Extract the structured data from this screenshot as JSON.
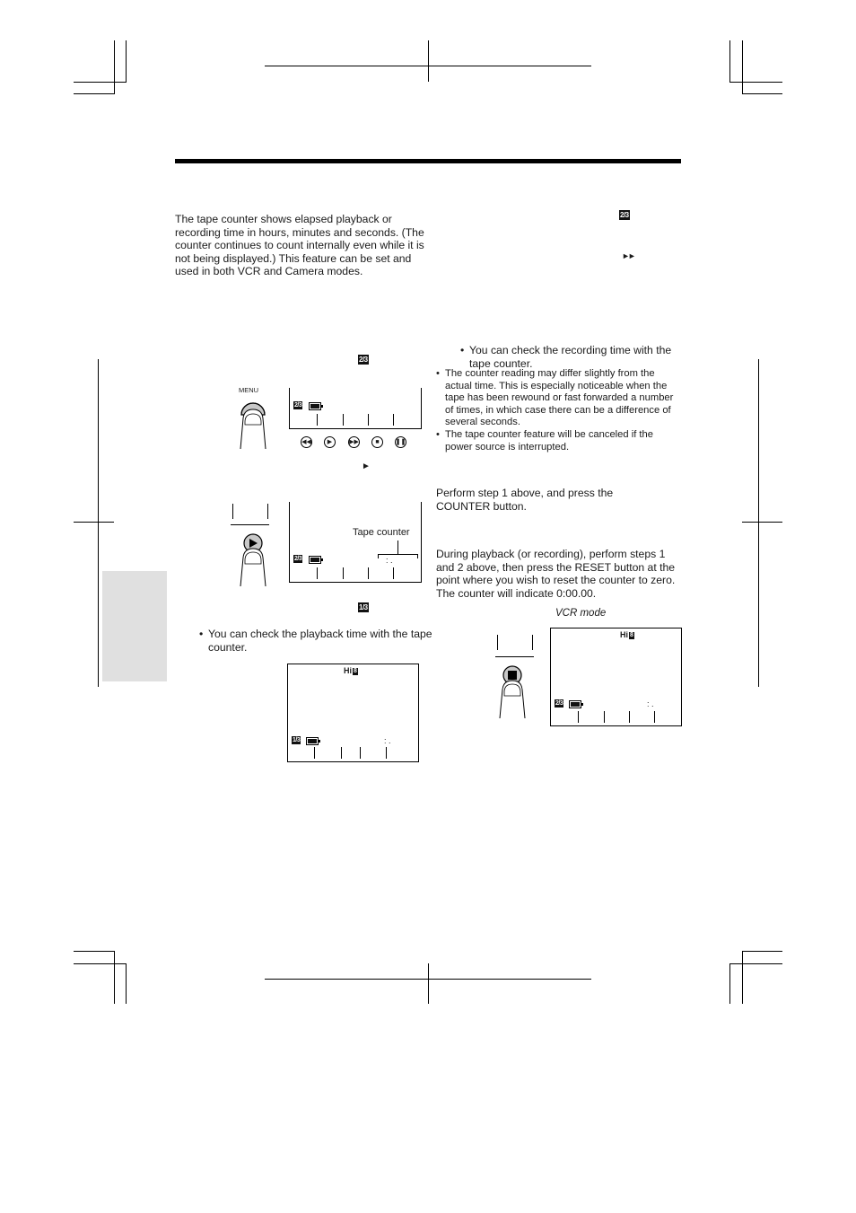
{
  "page": {
    "intro_paragraph": "The tape counter shows elapsed playback or recording time in hours, minutes and seconds. (The counter continues to count internally even while it is not being displayed.) This feature can be set and used in both VCR and Camera modes.",
    "left_column": {
      "step1_page_badge": "2/3",
      "menu_button_label": "MENU",
      "screen1_badge": "2/3",
      "controls": [
        "rewind",
        "play",
        "fast-forward",
        "stop",
        "pause"
      ],
      "play_arrow_glyph": "►",
      "screen2_badge": "2/3",
      "tape_counter_label": "Tape counter",
      "counter_separators": ":    .",
      "step3_page_badge": "1/3",
      "playback_bullet": "You can check the playback time with the tape counter.",
      "screen3_tape_format": "Hi",
      "screen3_tape_format_badge": "8",
      "screen3_badge": "1/3"
    },
    "right_column": {
      "top_badge": "2/3",
      "ff_glyph": "►►",
      "recording_bullet": "You can check the recording time with the tape counter.",
      "notes": [
        "The counter reading may differ slightly from the actual time. This is especially noticeable when the tape has been rewound or fast forwarded a number of times, in which case there can be a difference of several seconds.",
        "The tape counter feature will be canceled if the power source is interrupted."
      ],
      "cancel_paragraph": "Perform step 1 above, and press the COUNTER button.",
      "reset_paragraph": "During playback (or recording), perform steps 1 and 2 above, then press the RESET button at the point where you wish to reset the counter to zero. The counter will indicate 0:00.00.",
      "vcr_mode_caption": "VCR mode",
      "screen4_tape_format": "Hi",
      "screen4_tape_format_badge": "8",
      "screen4_badge": "2/3",
      "counter_separators": ":    ."
    },
    "colors": {
      "side_tab": "#e0e0e0",
      "ink": "#000000",
      "finger_button": "#c8c8c8"
    }
  }
}
